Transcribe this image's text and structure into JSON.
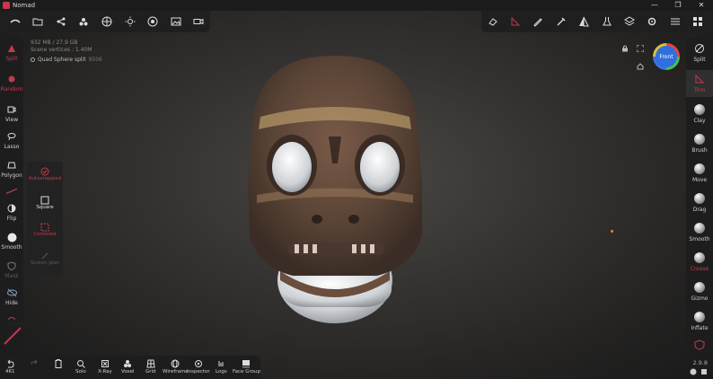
{
  "window": {
    "title": "Nomad",
    "controls": [
      "—",
      "❐",
      "✕"
    ]
  },
  "info": {
    "line1": "932 MB / 27.9 GB",
    "line2": "Scene vertices : 1.40M"
  },
  "mesh": {
    "name": "Quad Sphere split",
    "count": "9506"
  },
  "left_tools": [
    {
      "label": "Split"
    },
    {
      "label": "Random"
    },
    {
      "label": "View"
    },
    {
      "label": "Lasso"
    },
    {
      "label": "Polygon"
    },
    {
      "label": "Flip"
    },
    {
      "label": "Smooth"
    },
    {
      "label": "Mask"
    },
    {
      "label": "Hide"
    }
  ],
  "flip_popup": [
    {
      "label": "Autosnapped"
    },
    {
      "label": "Square"
    },
    {
      "label": "Centered"
    },
    {
      "label": "Screen plan"
    }
  ],
  "right_tools": [
    {
      "label": "Split"
    },
    {
      "label": "Trim"
    },
    {
      "label": "Clay"
    },
    {
      "label": "Brush"
    },
    {
      "label": "Move"
    },
    {
      "label": "Drag"
    },
    {
      "label": "Smooth"
    },
    {
      "label": "Crease"
    },
    {
      "label": "Gizmo"
    },
    {
      "label": "Inflate"
    }
  ],
  "bottom": {
    "undo_count": "461",
    "items": [
      "Solo",
      "X-Ray",
      "Voxel",
      "Grid",
      "Wireframe",
      "Inspector",
      "Logs",
      "Face Group"
    ]
  },
  "gizmo": {
    "label": "Front"
  },
  "version": "2.9.8",
  "colors": {
    "accent": "#c33a4e",
    "gizmo_center": "#2f6fe0"
  }
}
